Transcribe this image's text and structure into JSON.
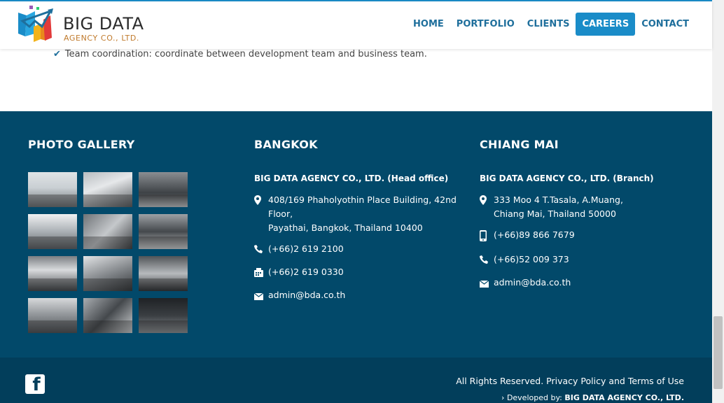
{
  "header": {
    "logo_line1": "BIG DATA",
    "logo_line2": "AGENCY CO., LTD.",
    "nav": [
      "HOME",
      "PORTFOLIO",
      "CLIENTS",
      "CAREERS",
      "CONTACT"
    ],
    "active_nav": "CAREERS"
  },
  "content": {
    "bullet": "Team coordination: coordinate between development team and business team."
  },
  "footer": {
    "gallery_title": "PHOTO GALLERY",
    "bangkok": {
      "title": "BANGKOK",
      "company": "BIG DATA AGENCY CO., LTD. (Head office)",
      "address": "408/169 Phaholyothin Place Building, 42nd Floor,\nPayathai, Bangkok, Thailand 10400",
      "phone": "(+66)2 619 2100",
      "fax": "(+66)2 619 0330",
      "email": "admin@bda.co.th"
    },
    "chiangmai": {
      "title": "CHIANG MAI",
      "company": "BIG DATA AGENCY CO., LTD. (Branch)",
      "address": "333 Moo 4 T.Tasala, A.Muang,\nChiang Mai, Thailand 50000",
      "mobile": "(+66)89 866 7679",
      "phone": "(+66)52 009 373",
      "email": "admin@bda.co.th"
    }
  },
  "bottom": {
    "facebook_letter": "f",
    "rights": "All Rights Reserved. Privacy Policy and Terms of Use",
    "developed_prefix": "Developed by:",
    "developed_by": "BIG DATA AGENCY CO., LTD."
  },
  "colors": {
    "accent": "#1a8cc8",
    "nav_text": "#1f6f9c",
    "footer_bg": "#02496a",
    "bottom_bg": "#023e5b"
  }
}
